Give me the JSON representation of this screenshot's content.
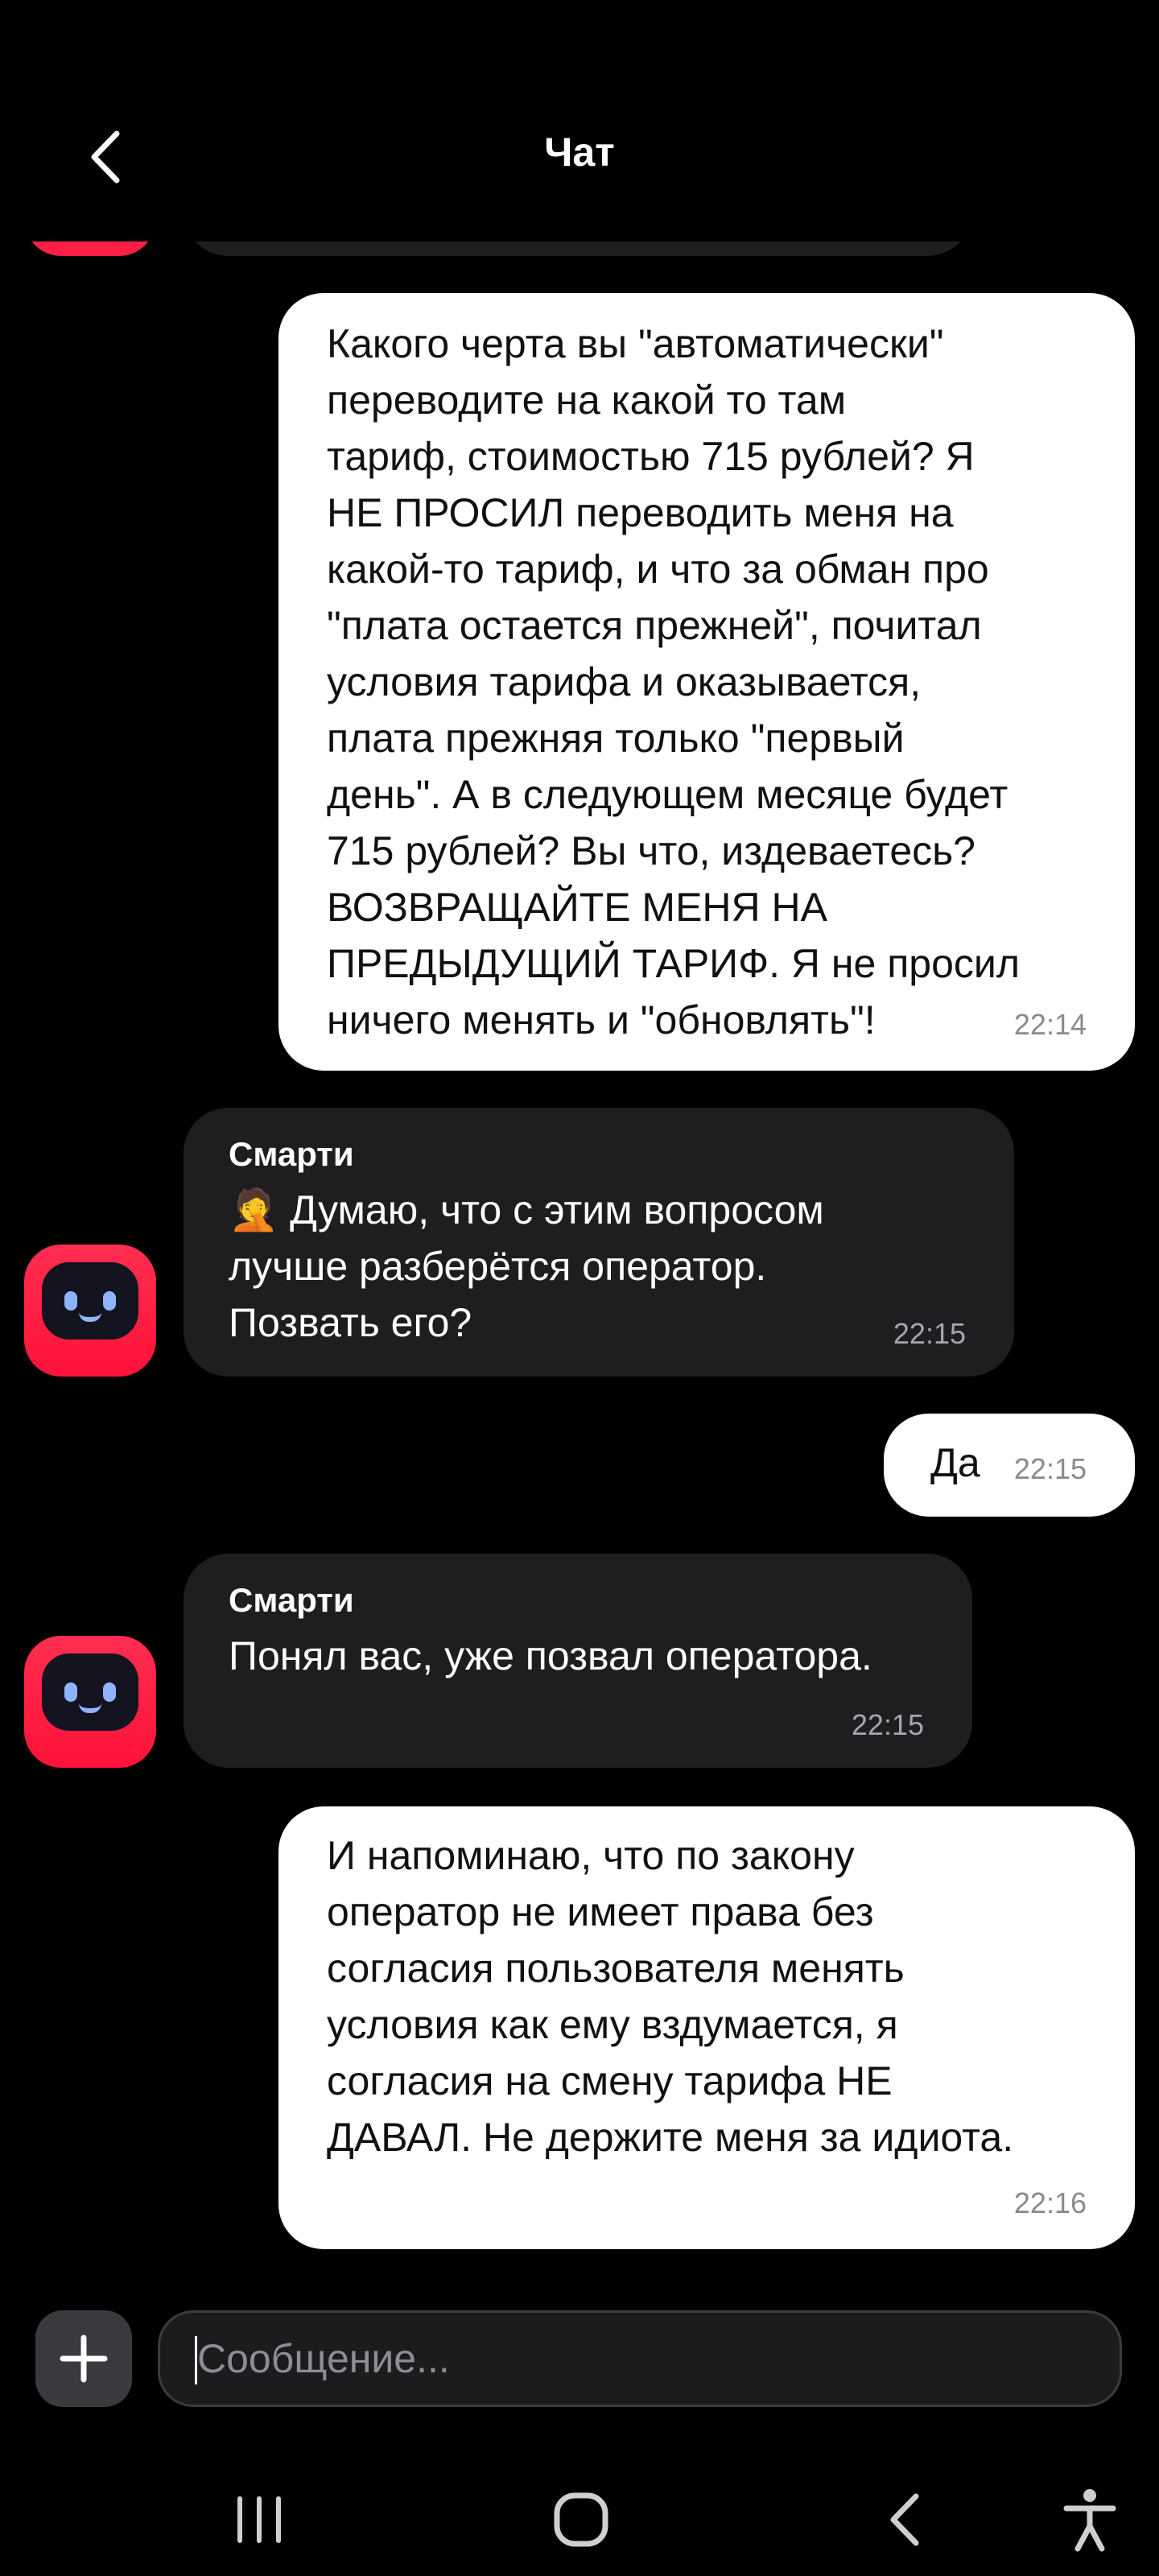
{
  "header": {
    "title": "Чат"
  },
  "messages": [
    {
      "id": "m1",
      "direction": "out",
      "text": "Какого черта вы \"автоматически\"\nпереводите на какой то там\nтариф, стоимостью 715 рублей? Я\nНЕ ПРОСИЛ переводить меня на\nкакой-то тариф, и что за обман про\n\"плата остается прежней\", почитал\nусловия тарифа и оказывается,\nплата прежняя только \"первый\nдень\". А в следующем месяце будет\n715 рублей? Вы что, издеваетесь?\nВОЗВРАЩАЙТЕ МЕНЯ НА\nПРЕДЫДУЩИЙ ТАРИФ. Я не просил\nничего менять и \"обновлять\"!",
      "time": "22:14"
    },
    {
      "id": "m2",
      "direction": "in",
      "sender": "Смарти",
      "text": "🤦 Думаю, что с этим вопросом\nлучше разберётся оператор.\nПозвать его?",
      "time": "22:15"
    },
    {
      "id": "m3",
      "direction": "out",
      "text": "Да",
      "time": "22:15"
    },
    {
      "id": "m4",
      "direction": "in",
      "sender": "Смарти",
      "text": "Понял вас, уже позвал оператора.",
      "time": "22:15"
    },
    {
      "id": "m5",
      "direction": "out",
      "text": "И напоминаю, что по закону\nоператор не имеет права без\nсогласия пользователя менять\nусловия как ему вздумается, я\nсогласия на смену тарифа НЕ\nДАВАЛ. Не держите меня за идиота.",
      "time": "22:16"
    }
  ],
  "composer": {
    "placeholder": "Сообщение...",
    "value": ""
  },
  "icons": {
    "back": "chevron-left-icon",
    "avatar": "robot-avatar-icon",
    "add": "plus-icon",
    "nav_recents": "recents-icon",
    "nav_home": "home-icon",
    "nav_back": "back-icon",
    "nav_accessibility": "accessibility-icon"
  },
  "colors": {
    "background": "#000000",
    "outgoing_bubble": "#ffffff",
    "incoming_bubble": "#1e1e21",
    "avatar_brand": "#ff1f44",
    "timestamp": "#8a8a8f"
  }
}
